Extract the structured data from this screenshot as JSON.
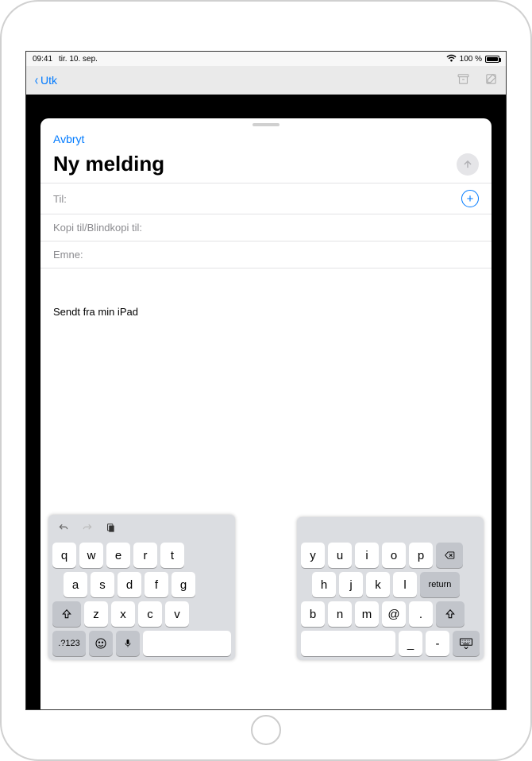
{
  "status": {
    "time": "09:41",
    "date": "tir. 10. sep.",
    "battery_pct": "100 %"
  },
  "bg": {
    "back_label": "Utk"
  },
  "compose": {
    "cancel": "Avbryt",
    "title": "Ny melding",
    "to_label": "Til:",
    "cc_label": "Kopi til/Blindkopi til:",
    "subject_label": "Emne:",
    "signature": "Sendt fra min iPad"
  },
  "keyboard": {
    "left": {
      "row1": [
        "q",
        "w",
        "e",
        "r",
        "t"
      ],
      "row2": [
        "a",
        "s",
        "d",
        "f",
        "g"
      ],
      "row3": [
        "z",
        "x",
        "c",
        "v"
      ],
      "num_label": ".?123"
    },
    "right": {
      "row1": [
        "y",
        "u",
        "i",
        "o",
        "p"
      ],
      "row2": [
        "h",
        "j",
        "k",
        "l"
      ],
      "row3": [
        "b",
        "n",
        "m",
        "@",
        "."
      ],
      "return_label": "return"
    }
  }
}
